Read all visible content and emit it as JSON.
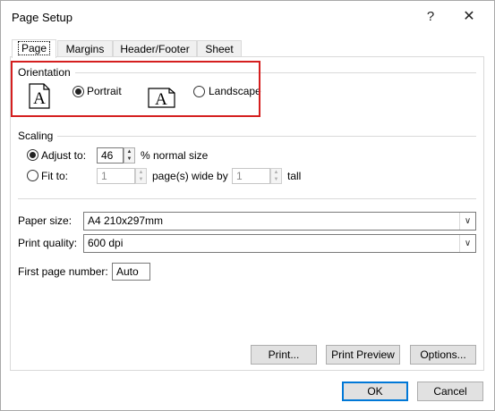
{
  "window": {
    "title": "Page Setup",
    "help_glyph": "?",
    "close_glyph": "✕"
  },
  "tabs": [
    {
      "label": "Page",
      "active": true
    },
    {
      "label": "Margins",
      "active": false
    },
    {
      "label": "Header/Footer",
      "active": false
    },
    {
      "label": "Sheet",
      "active": false
    }
  ],
  "orientation": {
    "group_label": "Orientation",
    "portrait_label": "Portrait",
    "landscape_label": "Landscape",
    "selected": "portrait",
    "icon_letter": "A"
  },
  "scaling": {
    "group_label": "Scaling",
    "adjust_label": "Adjust to:",
    "adjust_value": "46",
    "adjust_suffix": "% normal size",
    "fit_label": "Fit to:",
    "fit_wide_value": "1",
    "fit_wide_suffix": "page(s) wide by",
    "fit_tall_value": "1",
    "fit_tall_suffix": "tall",
    "selected": "adjust"
  },
  "paper": {
    "size_label": "Paper size:",
    "size_value": "A4 210x297mm",
    "quality_label": "Print quality:",
    "quality_value": "600 dpi",
    "first_page_label": "First page number:",
    "first_page_value": "Auto"
  },
  "buttons": {
    "print": "Print...",
    "print_preview": "Print Preview",
    "options": "Options...",
    "ok": "OK",
    "cancel": "Cancel"
  },
  "highlight_color": "#d51f1f"
}
